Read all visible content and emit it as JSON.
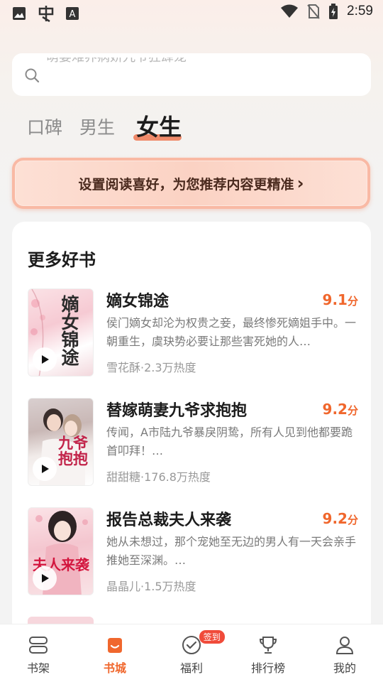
{
  "status_bar": {
    "time": "2:59",
    "left_icons": [
      "image-icon",
      "app-icon",
      "font-icon"
    ],
    "right_icons": [
      "wifi-icon",
      "no-sim-icon",
      "battery-icon"
    ]
  },
  "search": {
    "placeholder": "萌妻难养病娇九爷狂肆宠"
  },
  "tabs": [
    {
      "label": "口碑",
      "active": false
    },
    {
      "label": "男生",
      "active": false
    },
    {
      "label": "女生",
      "active": true
    }
  ],
  "pref_banner": {
    "label": "设置阅读喜好，为您推荐内容更精准",
    "chevron": "›"
  },
  "section": {
    "title": "更多好书"
  },
  "books": [
    {
      "title": "嫡女锦途",
      "score": "9.1",
      "score_unit": "分",
      "desc": "侯门嫡女却沦为权贵之妾，最终惨死嫡姐手中。一朝重生，虞玦势必要让那些害死她的人…",
      "meta": "雪花酥·2.3万热度",
      "cover_text": "嫡女锦途"
    },
    {
      "title": "替嫁萌妻九爷求抱抱",
      "score": "9.2",
      "score_unit": "分",
      "desc": "传闻，A市陆九爷暴戾阴鸷，所有人见到他都要跪首叩拜！…",
      "meta": "甜甜糖·176.8万热度",
      "cover_text": "九爷抱抱"
    },
    {
      "title": "报告总裁夫人来袭",
      "score": "9.2",
      "score_unit": "分",
      "desc": "她从未想过，那个宠她至无边的男人有一天会亲手推她至深渊。…",
      "meta": "晶晶儿·1.5万热度",
      "cover_text": "夫人来袭"
    }
  ],
  "bottom_nav": [
    {
      "label": "书架",
      "icon": "bookshelf-icon",
      "active": false
    },
    {
      "label": "书城",
      "icon": "bookstore-icon",
      "active": true
    },
    {
      "label": "福利",
      "icon": "rewards-icon",
      "active": false,
      "badge": "签到"
    },
    {
      "label": "排行榜",
      "icon": "trophy-icon",
      "active": false
    },
    {
      "label": "我的",
      "icon": "profile-icon",
      "active": false
    }
  ],
  "colors": {
    "accent": "#f0672d",
    "tab_underline": "#f08a6a",
    "badge": "#f04b3a"
  }
}
